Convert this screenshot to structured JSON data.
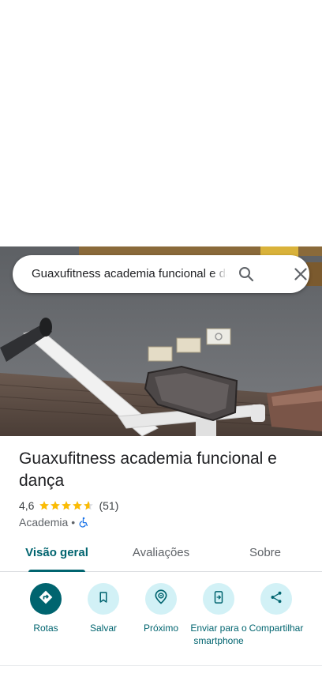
{
  "search": {
    "query": "Guaxufitness academia funcional e dança"
  },
  "place": {
    "name": "Guaxufitness academia funcional e dança",
    "rating": "4,6",
    "stars": 4.6,
    "review_count": "(51)",
    "category": "Academia",
    "separator": "•",
    "accessibility_icon": "wheelchair-icon"
  },
  "tabs": [
    {
      "label": "Visão geral",
      "active": true
    },
    {
      "label": "Avaliações",
      "active": false
    },
    {
      "label": "Sobre",
      "active": false
    }
  ],
  "actions": [
    {
      "label": "Rotas",
      "icon": "directions-icon"
    },
    {
      "label": "Salvar",
      "icon": "bookmark-icon"
    },
    {
      "label": "Próximo",
      "icon": "nearby-icon"
    },
    {
      "label": "Enviar para o smartphone",
      "icon": "send-to-phone-icon"
    },
    {
      "label": "Compartilhar",
      "icon": "share-icon"
    }
  ],
  "colors": {
    "accent": "#00646f",
    "action_bg": "#d2f1f6",
    "star": "#fbbc04"
  }
}
